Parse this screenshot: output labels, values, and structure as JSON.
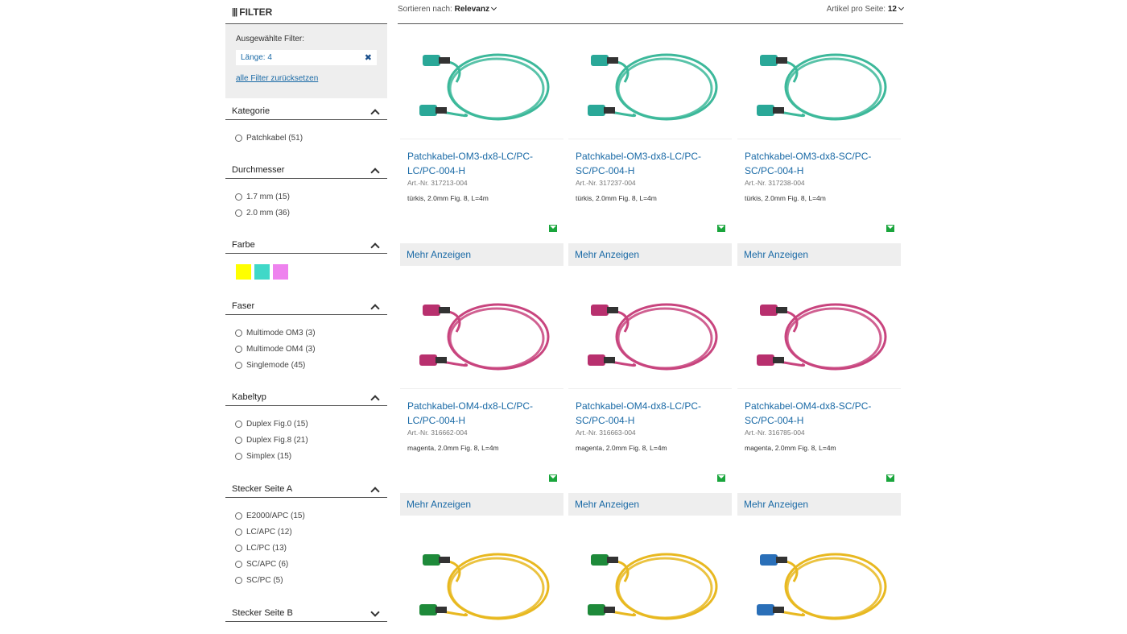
{
  "filter": {
    "title": "FILTER",
    "selected_label": "Ausgewählte Filter:",
    "chip": "Länge: 4",
    "reset": "alle Filter zurücksetzen"
  },
  "groups": [
    {
      "title": "Kategorie",
      "expanded": true,
      "options": [
        "Patchkabel (51)"
      ]
    },
    {
      "title": "Durchmesser",
      "expanded": true,
      "options": [
        "1.7 mm (15)",
        "2.0 mm (36)"
      ]
    },
    {
      "title": "Farbe",
      "expanded": true,
      "swatches": [
        "#ffff00",
        "#40d8c8",
        "#ee82ee"
      ]
    },
    {
      "title": "Faser",
      "expanded": true,
      "options": [
        "Multimode OM3 (3)",
        "Multimode OM4 (3)",
        "Singlemode (45)"
      ]
    },
    {
      "title": "Kabeltyp",
      "expanded": true,
      "options": [
        "Duplex Fig.0 (15)",
        "Duplex Fig.8 (21)",
        "Simplex (15)"
      ]
    },
    {
      "title": "Stecker Seite A",
      "expanded": true,
      "options": [
        "E2000/APC (15)",
        "LC/APC (12)",
        "LC/PC (13)",
        "SC/APC (6)",
        "SC/PC (5)"
      ]
    },
    {
      "title": "Stecker Seite B",
      "expanded": false,
      "options": []
    }
  ],
  "sort": {
    "label": "Sortieren nach:",
    "value": "Relevanz",
    "per_page_label": "Artikel pro Seite:",
    "per_page_value": "12"
  },
  "more_label": "Mehr Anzeigen",
  "products": [
    {
      "title": "Patchkabel-OM3-dx8-LC/PC-LC/PC-004-H",
      "art": "Art.-Nr. 317213-004",
      "desc": "türkis, 2.0mm Fig. 8, L=4m",
      "cable": "#3cb89a",
      "plug": "#2aa898"
    },
    {
      "title": "Patchkabel-OM3-dx8-LC/PC-SC/PC-004-H",
      "art": "Art.-Nr. 317237-004",
      "desc": "türkis, 2.0mm Fig. 8, L=4m",
      "cable": "#3cb89a",
      "plug": "#2aa898"
    },
    {
      "title": "Patchkabel-OM3-dx8-SC/PC-SC/PC-004-H",
      "art": "Art.-Nr. 317238-004",
      "desc": "türkis, 2.0mm Fig. 8, L=4m",
      "cable": "#3cb89a",
      "plug": "#2aa898"
    },
    {
      "title": "Patchkabel-OM4-dx8-LC/PC-LC/PC-004-H",
      "art": "Art.-Nr. 316662-004",
      "desc": "magenta, 2.0mm Fig. 8, L=4m",
      "cable": "#c8447e",
      "plug": "#b8306e"
    },
    {
      "title": "Patchkabel-OM4-dx8-LC/PC-SC/PC-004-H",
      "art": "Art.-Nr. 316663-004",
      "desc": "magenta, 2.0mm Fig. 8, L=4m",
      "cable": "#c8447e",
      "plug": "#b8306e"
    },
    {
      "title": "Patchkabel-OM4-dx8-SC/PC-SC/PC-004-H",
      "art": "Art.-Nr. 316785-004",
      "desc": "magenta, 2.0mm Fig. 8, L=4m",
      "cable": "#c8447e",
      "plug": "#b8306e"
    },
    {
      "cable": "#e8b820",
      "plug": "#1e8a3a"
    },
    {
      "cable": "#e8b820",
      "plug": "#1e8a3a"
    },
    {
      "cable": "#e8b820",
      "plug": "#2a6fb8"
    }
  ]
}
